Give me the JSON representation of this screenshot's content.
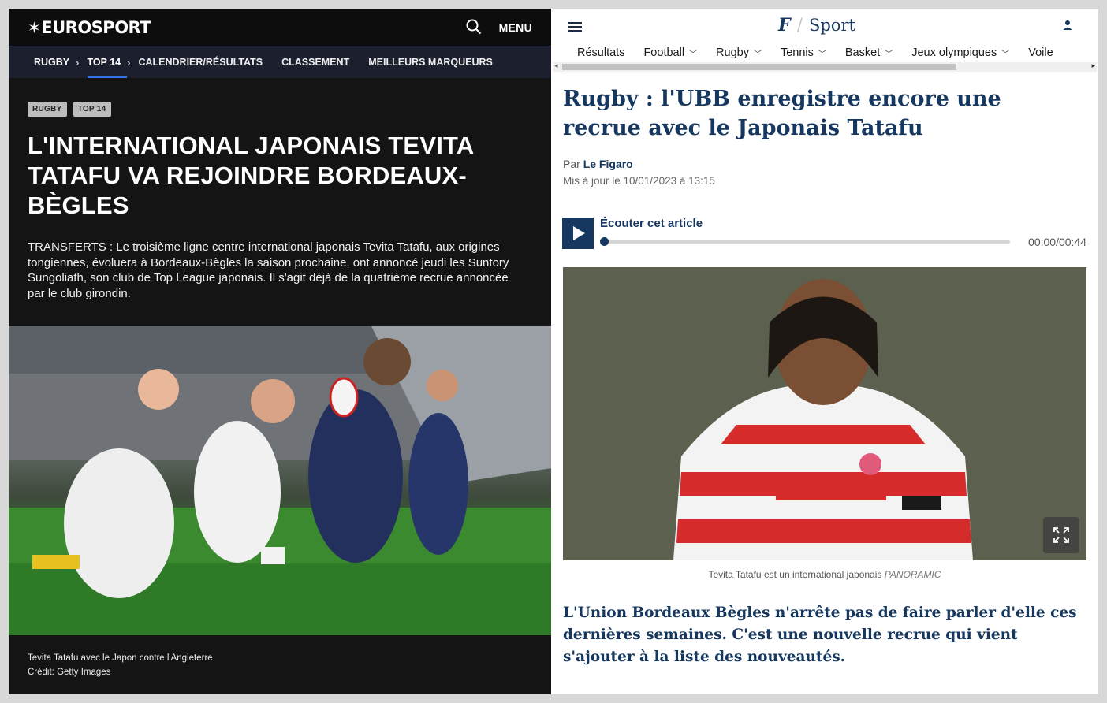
{
  "eurosport": {
    "logo": "EUROSPORT",
    "menu_label": "MENU",
    "nav": {
      "crumb_sport": "RUGBY",
      "crumb_league": "TOP 14",
      "items": [
        "CALENDRIER/RÉSULTATS",
        "CLASSEMENT",
        "MEILLEURS MARQUEURS"
      ]
    },
    "tags": [
      "RUGBY",
      "TOP 14"
    ],
    "title": "L'INTERNATIONAL JAPONAIS TEVITA TATAFU VA REJOINDRE BORDEAUX-BÈGLES",
    "lead": "TRANSFERTS : Le troisième ligne centre international japonais Tevita Tatafu, aux origines tongiennes, évoluera à Bordeaux-Bègles la saison prochaine, ont annoncé jeudi les Suntory Sungoliath, son club de Top League japonais. Il s'agit déjà de la quatrième recrue annoncée par le club girondin.",
    "caption": "Tevita Tatafu avec le Japon contre l'Angleterre",
    "credit": "Crédit: Getty Images"
  },
  "figaro": {
    "section": "Sport",
    "nav": [
      {
        "label": "Résultats",
        "dropdown": false
      },
      {
        "label": "Football",
        "dropdown": true
      },
      {
        "label": "Rugby",
        "dropdown": true
      },
      {
        "label": "Tennis",
        "dropdown": true
      },
      {
        "label": "Basket",
        "dropdown": true
      },
      {
        "label": "Jeux olympiques",
        "dropdown": true
      },
      {
        "label": "Voile",
        "dropdown": false
      }
    ],
    "title": "Rugby : l'UBB enregistre encore une recrue avec le Japonais Tatafu",
    "by_prefix": "Par",
    "author": "Le Figaro",
    "updated": "Mis à jour le 10/01/2023 à 13:15",
    "audio": {
      "label": "Écouter cet article",
      "time": "00:00/00:44",
      "progress": 0
    },
    "caption": "Tevita Tatafu est un international japonais",
    "caption_credit": "PANORAMIC",
    "lead": "L'Union Bordeaux Bègles n'arrête pas de faire parler d'elle ces dernières semaines. C'est une nouvelle recrue qui vient s'ajouter à la liste des nouveautés."
  },
  "colors": {
    "eurosport_bg": "#141414",
    "eurosport_nav_bg": "#1b1f2e",
    "eurosport_accent": "#3a6df0",
    "figaro_navy": "#163860"
  }
}
